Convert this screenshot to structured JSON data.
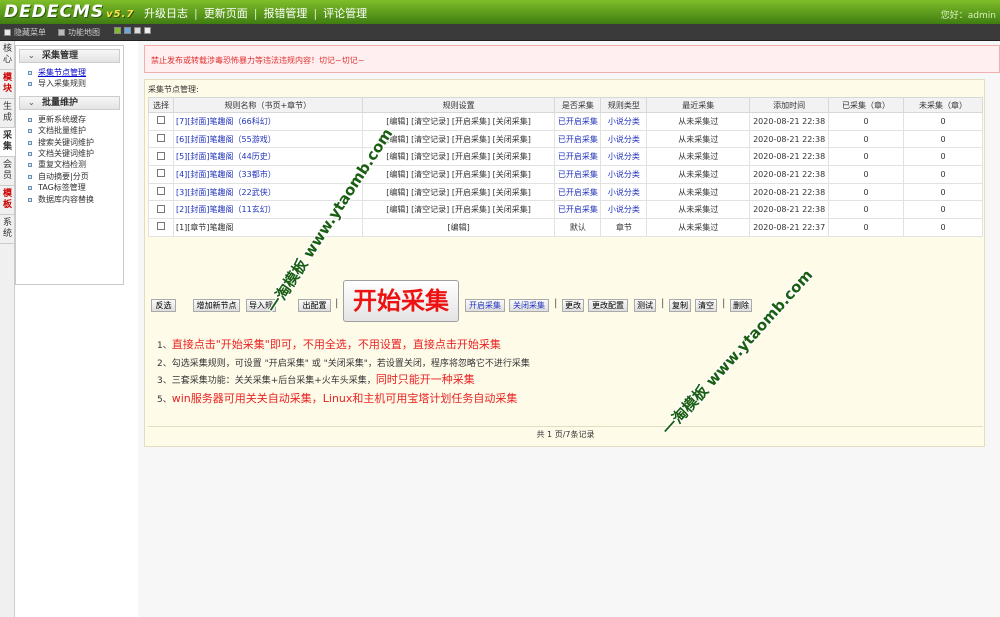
{
  "topbar": {
    "logo": "DEDECMS",
    "version": "v5.7",
    "nav": [
      "升级日志",
      "更新页面",
      "报错管理",
      "评论管理"
    ],
    "greeting": "您好：admin"
  },
  "subbar": {
    "hide_menu": "隐藏菜单",
    "function_map": "功能地图"
  },
  "vtabs": [
    "核心",
    "模块",
    "生成",
    "采集",
    "会员",
    "模板",
    "系统"
  ],
  "left_menu": {
    "groups": [
      {
        "title": "采集管理",
        "items": [
          "采集节点管理",
          "导入采集规则"
        ]
      },
      {
        "title": "批量维护",
        "items": [
          "更新系统缓存",
          "文档批量维护",
          "搜索关键词维护",
          "文档关键词维护",
          "重复文档检测",
          "自动摘要|分页",
          "TAG标签管理",
          "数据库内容替换"
        ]
      }
    ]
  },
  "warning": "禁止发布或转载涉毒恐怖暴力等违法违规内容！切记~切记~",
  "panel_title": "采集节点管理:",
  "table": {
    "headers": [
      "选择",
      "规则名称（书页+章节）",
      "规则设置",
      "是否采集",
      "规则类型",
      "最近采集",
      "添加时间",
      "已采集（章）",
      "未采集（章）"
    ],
    "rows": [
      {
        "name": "[7][封面]笔趣阁（66科幻）",
        "settings": "[编辑] [清空记录] [开启采集] [关闭采集]",
        "collect": "已开启采集",
        "type": "小说分类",
        "last": "从未采集过",
        "added": "2020-08-21 22:38",
        "done": "0",
        "todo": "0"
      },
      {
        "name": "[6][封面]笔趣阁（55游戏）",
        "settings": "[编辑] [清空记录] [开启采集] [关闭采集]",
        "collect": "已开启采集",
        "type": "小说分类",
        "last": "从未采集过",
        "added": "2020-08-21 22:38",
        "done": "0",
        "todo": "0"
      },
      {
        "name": "[5][封面]笔趣阁（44历史）",
        "settings": "[编辑] [清空记录] [开启采集] [关闭采集]",
        "collect": "已开启采集",
        "type": "小说分类",
        "last": "从未采集过",
        "added": "2020-08-21 22:38",
        "done": "0",
        "todo": "0"
      },
      {
        "name": "[4][封面]笔趣阁（33都市）",
        "settings": "[编辑] [清空记录] [开启采集] [关闭采集]",
        "collect": "已开启采集",
        "type": "小说分类",
        "last": "从未采集过",
        "added": "2020-08-21 22:38",
        "done": "0",
        "todo": "0"
      },
      {
        "name": "[3][封面]笔趣阁（22武侠）",
        "settings": "[编辑] [清空记录] [开启采集] [关闭采集]",
        "collect": "已开启采集",
        "type": "小说分类",
        "last": "从未采集过",
        "added": "2020-08-21 22:38",
        "done": "0",
        "todo": "0"
      },
      {
        "name": "[2][封面]笔趣阁（11玄幻）",
        "settings": "[编辑] [清空记录] [开启采集] [关闭采集]",
        "collect": "已开启采集",
        "type": "小说分类",
        "last": "从未采集过",
        "added": "2020-08-21 22:38",
        "done": "0",
        "todo": "0"
      },
      {
        "name": "[1][章节]笔趣阁",
        "settings": "[编辑]",
        "collect": "默认",
        "type": "章节",
        "last": "从未采集过",
        "added": "2020-08-21 22:37",
        "done": "0",
        "todo": "0"
      }
    ]
  },
  "buttons": {
    "invert": "反选",
    "add_node": "增加新节点",
    "import_rule": "导入规",
    "export_config": "出配置",
    "start_collect": "开始采集",
    "enable": "开启采集",
    "disable": "关闭采集",
    "edit": "更改",
    "edit_config": "更改配置",
    "test": "测试",
    "copy": "复制",
    "clear": "清空",
    "delete": "删除"
  },
  "notes": {
    "n1_prefix": "1、",
    "n1_red": "直接点击\"开始采集\"即可，不用全选，不用设置，直接点击开始采集",
    "n2": "2、勾选采集规则，可设置 \"开启采集\" 或 \"关闭采集\"，若设置关闭，程序将忽略它不进行采集",
    "n3_prefix": "3、三套采集功能：关关采集+后台采集+火车头采集，",
    "n3_red": "同时只能开一种采集",
    "n5_prefix": "5、",
    "n5_red": "win服务器可用关关自动采集，Linux和主机可用宝塔计划任务自动采集"
  },
  "pagination": "共 1 页/7条记录",
  "watermarks": [
    "一淘模板 www.ytaomb.com",
    "一淘模板 www.ytaomb.com",
    "一淘模板 www.ytaomb.com"
  ]
}
